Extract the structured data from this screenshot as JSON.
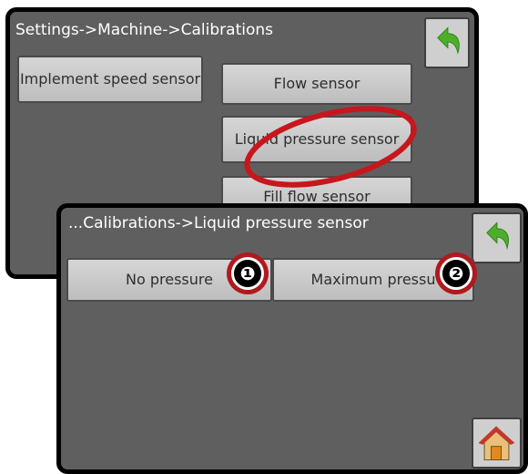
{
  "back_screen": {
    "title": "Settings->Machine->Calibrations",
    "buttons": {
      "implement_speed": "Implement speed sensor",
      "flow": "Flow sensor",
      "liquid_pressure": "Liquid pressure sensor",
      "fill_flow": "Fill flow sensor"
    }
  },
  "front_screen": {
    "title": "...Calibrations->Liquid pressure sensor",
    "buttons": {
      "no_pressure": "No pressure",
      "maximum_pressure": "Maximum pressu"
    }
  },
  "callouts": [
    "❶",
    "❷"
  ],
  "colors": {
    "screen_bg": "#5f5f5f",
    "highlight": "#c8161d",
    "back_arrow": "#4caf2a"
  },
  "icons": {
    "back": "back-arrow-icon",
    "home": "home-icon"
  }
}
